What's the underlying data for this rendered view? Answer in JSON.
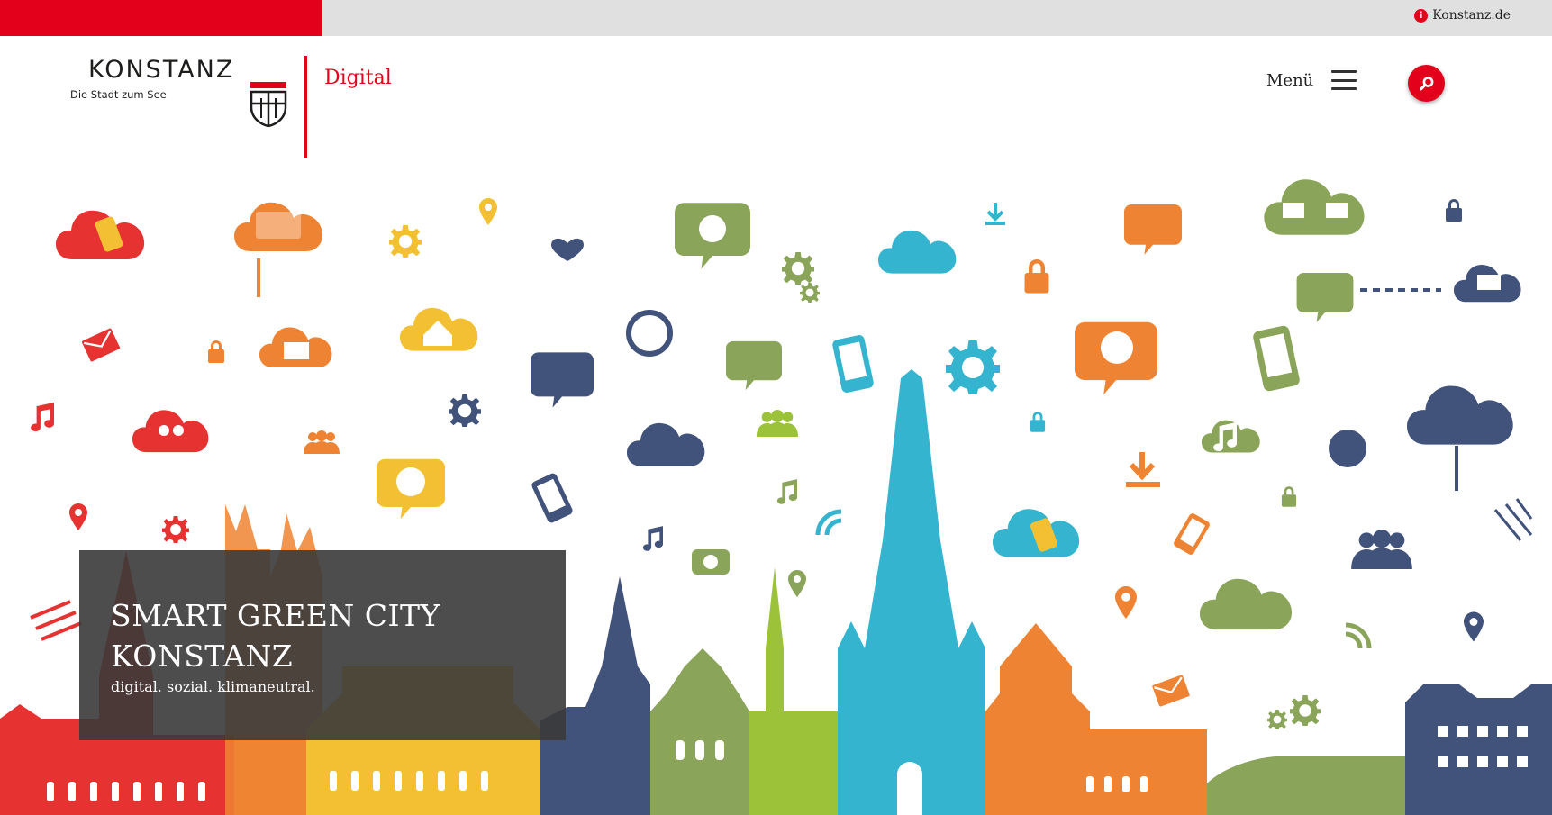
{
  "topbar": {
    "link_label": "Konstanz.de",
    "info_icon_glyph": "i"
  },
  "header": {
    "logo_wordmark": "KONSTANZ",
    "logo_tagline": "Die Stadt zum See",
    "site_name": "Digital",
    "menu_label": "Menü",
    "icons": {
      "menu": "hamburger-icon",
      "search": "search-icon",
      "info": "info-icon"
    }
  },
  "hero": {
    "title_line1": "SMART GREEN CITY",
    "title_line2": "KONSTANZ",
    "subtitle": "digital. sozial. klimaneutral."
  },
  "colors": {
    "brand_red": "#e2001a",
    "topbar_gray": "#e0e0e0",
    "overlay": "#3a3a3a",
    "illustration_palette": [
      "#e63331",
      "#ee8433",
      "#f3c033",
      "#41527b",
      "#8aa45a",
      "#9cc23a",
      "#35b4d0"
    ]
  }
}
